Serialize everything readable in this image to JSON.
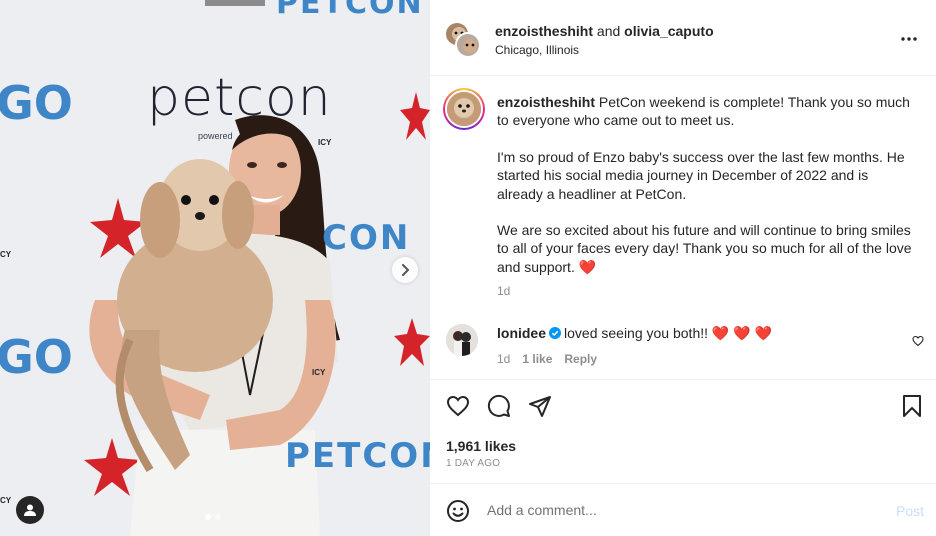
{
  "header": {
    "user1": "enzoistheshiht",
    "and_text": "and",
    "user2": "olivia_caputo",
    "location": "Chicago, Illinois",
    "more_icon": "more-horizontal-icon"
  },
  "backdrop": {
    "logo": "petcon",
    "logo_sub": "powered",
    "logo_sub2": "ICY",
    "con1": "CON",
    "con2": "PETCON",
    "con_top": "PETCON",
    "go1": "GO",
    "go2": "GO",
    "left_fragment": "CY",
    "right_fragment": "ICY",
    "left_fragment2": "CY"
  },
  "caption": {
    "username": "enzoistheshiht",
    "para1": "PetCon weekend is complete! Thank you so much to everyone who came out to meet us.",
    "para2": "I'm so proud of Enzo baby's success over the last few months. He started his social media journey in December of 2022 and is already a headliner at PetCon.",
    "para3": "We are so excited about his future and will continue to bring smiles to all of your faces every day! Thank you so much for all of the love and support.",
    "emoji": "❤️",
    "time": "1d"
  },
  "comment": {
    "username": "lonidee",
    "text": "loved seeing you both!!",
    "emojis": "❤️ ❤️ ❤️",
    "time": "1d",
    "likes": "1 like",
    "reply": "Reply"
  },
  "post": {
    "likes": "1,961 likes",
    "date": "1 DAY AGO"
  },
  "add_comment": {
    "placeholder": "Add a comment...",
    "post_label": "Post"
  },
  "colors": {
    "accent_blue": "#0095f6",
    "post_disabled": "#c8dffa",
    "backdrop_blue": "#3f86c8",
    "star_red": "#d4242a"
  }
}
